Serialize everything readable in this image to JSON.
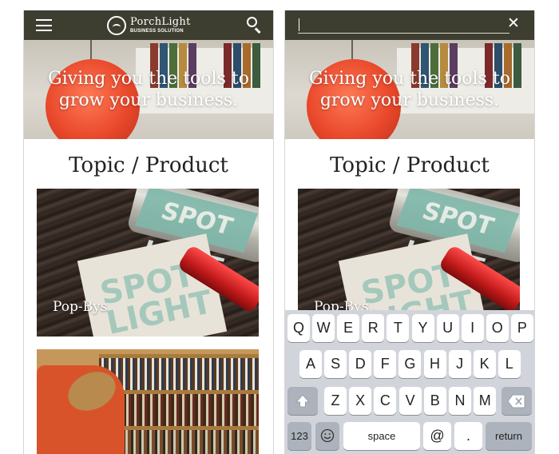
{
  "colors": {
    "header_bg": "#3d3e30",
    "keyboard_bg": "#d1d5db",
    "key_bg": "#ffffff",
    "special_key_bg": "#adb3bc"
  },
  "header": {
    "logo_name": "PorchLight",
    "logo_tagline": "BUSINESS SOLUTION",
    "menu_icon": "hamburger-menu-icon",
    "search_icon": "search-icon",
    "close_icon": "close-icon",
    "close_glyph": "✕"
  },
  "hero": {
    "title": "Giving you the tools to grow your business."
  },
  "section": {
    "title": "Topic / Product"
  },
  "cards": [
    {
      "label": "Pop-Bys",
      "image_words": "SPOT LIGHT"
    },
    {
      "label": ""
    }
  ],
  "keyboard": {
    "row1": [
      "Q",
      "W",
      "E",
      "R",
      "T",
      "Y",
      "U",
      "I",
      "O",
      "P"
    ],
    "row2": [
      "A",
      "S",
      "D",
      "F",
      "G",
      "H",
      "J",
      "K",
      "L"
    ],
    "row3": [
      "Z",
      "X",
      "C",
      "V",
      "B",
      "N",
      "M"
    ],
    "shift_icon": "shift-arrow-icon",
    "delete_icon": "backspace-icon",
    "emoji_icon": "emoji-icon",
    "numbers_label": "123",
    "space_label": "space",
    "at_label": "@",
    "period_label": ".",
    "return_label": "return"
  }
}
